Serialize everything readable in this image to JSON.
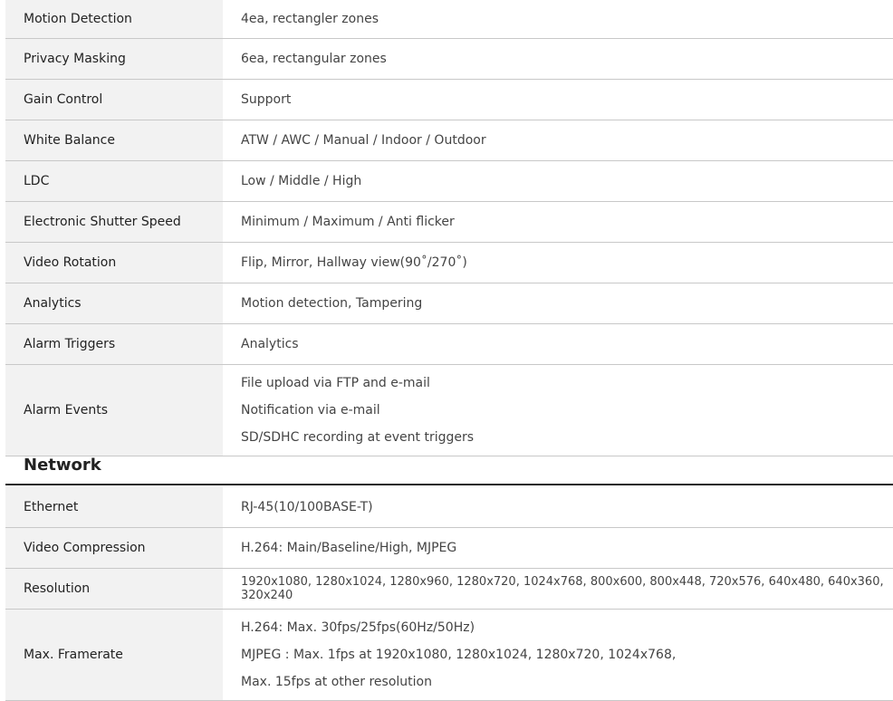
{
  "video_table": [
    {
      "label": "Motion Detection",
      "values": [
        "4ea, rectangler zones"
      ]
    },
    {
      "label": "Privacy Masking",
      "values": [
        "6ea, rectangular zones"
      ]
    },
    {
      "label": "Gain Control",
      "values": [
        "Support"
      ]
    },
    {
      "label": "White Balance",
      "values": [
        "ATW / AWC / Manual / Indoor / Outdoor"
      ]
    },
    {
      "label": "LDC",
      "values": [
        "Low / Middle / High"
      ]
    },
    {
      "label": "Electronic Shutter Speed",
      "values": [
        "Minimum / Maximum / Anti flicker"
      ]
    },
    {
      "label": "Video Rotation",
      "values": [
        "Flip, Mirror, Hallway view(90˚/270˚)"
      ]
    },
    {
      "label": "Analytics",
      "values": [
        "Motion detection, Tampering"
      ]
    },
    {
      "label": "Alarm Triggers",
      "values": [
        "Analytics"
      ]
    },
    {
      "label": "Alarm Events",
      "values": [
        "File upload via FTP and e-mail",
        "Notification via e-mail",
        "SD/SDHC recording at event triggers"
      ]
    }
  ],
  "network_section": {
    "title": "Network",
    "rows": [
      {
        "label": "Ethernet",
        "values": [
          "RJ-45(10/100BASE-T)"
        ]
      },
      {
        "label": "Video Compression",
        "values": [
          "H.264: Main/Baseline/High, MJPEG"
        ]
      },
      {
        "label": "Resolution",
        "values": [
          "1920x1080, 1280x1024, 1280x960, 1280x720, 1024x768, 800x600, 800x448, 720x576, 640x480, 640x360, 320x240"
        ]
      },
      {
        "label": "Max. Framerate",
        "values": [
          "H.264: Max. 30fps/25fps(60Hz/50Hz)",
          "MJPEG : Max. 1fps at 1920x1080, 1280x1024, 1280x720, 1024x768,",
          "Max. 15fps at other resolution"
        ]
      }
    ]
  }
}
